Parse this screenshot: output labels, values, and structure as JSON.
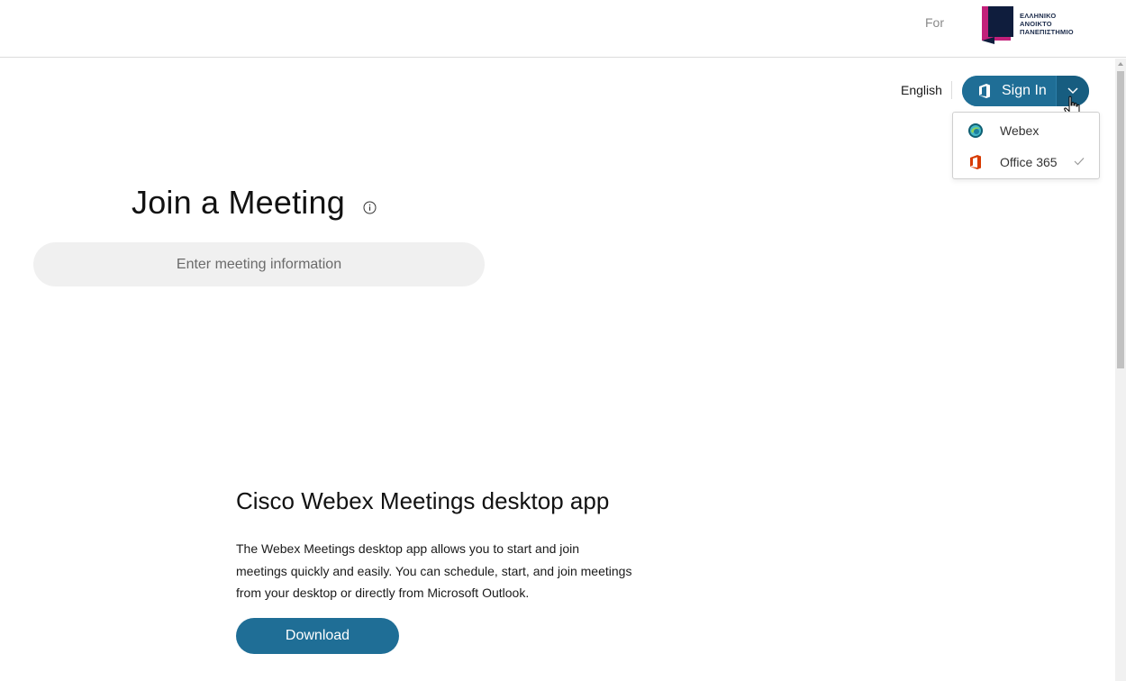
{
  "header": {
    "for_label": "For",
    "logo_text_line1": "ΕΛΛΗΝΙΚΟ",
    "logo_text_line2": "ΑΝΟΙΚΤΟ",
    "logo_text_line3": "ΠΑΝΕΠΙΣΤΗΜΙΟ"
  },
  "account": {
    "language": "English",
    "sign_in_label": "Sign In",
    "sign_in_icon": "office-icon",
    "dropdown_items": [
      {
        "label": "Webex",
        "icon": "webex-icon",
        "selected": false
      },
      {
        "label": "Office 365",
        "icon": "office-icon",
        "selected": true
      }
    ]
  },
  "join": {
    "title": "Join a Meeting",
    "placeholder": "Enter meeting information",
    "value": ""
  },
  "desktop_app": {
    "title": "Cisco Webex Meetings desktop app",
    "description": "The Webex Meetings desktop app allows you to start and join meetings quickly and easily. You can schedule, start, and join meetings from your desktop or directly from Microsoft Outlook.",
    "download_label": "Download"
  },
  "colors": {
    "primary": "#1f6e96",
    "office_red": "#d83b01",
    "input_bg": "#f0f0f0"
  }
}
